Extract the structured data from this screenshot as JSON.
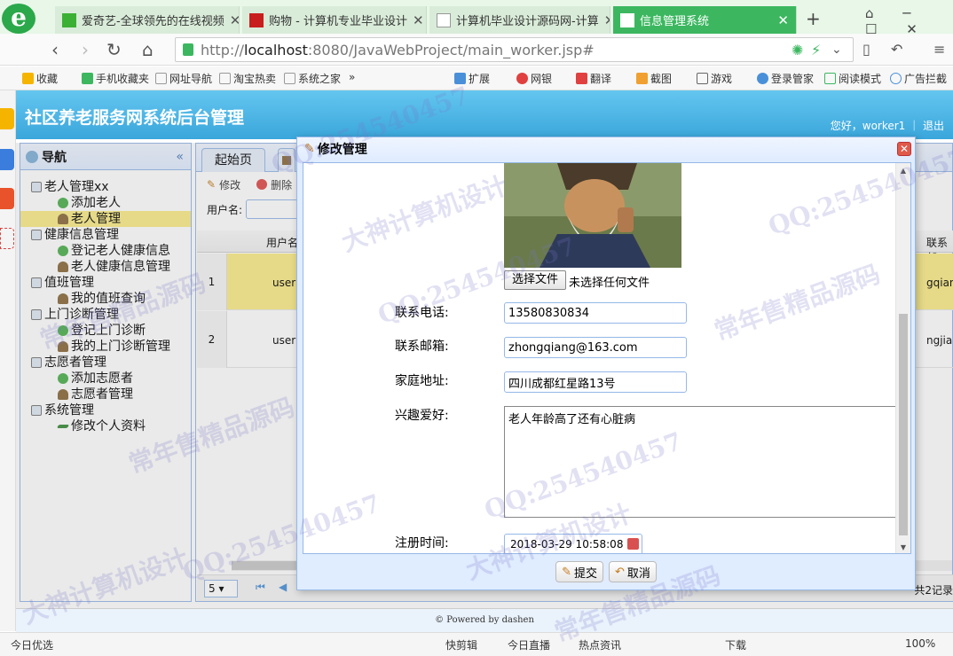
{
  "browser": {
    "tabs": [
      {
        "label": "爱奇艺-全球领先的在线视频",
        "favicon_color": "#3cb034"
      },
      {
        "label": "购物 - 计算机专业毕业设计",
        "favicon_color": "#c81e1e"
      },
      {
        "label": "计算机毕业设计源码网-计算",
        "favicon_color": "#ffffff"
      },
      {
        "label": "信息管理系统",
        "favicon_color": "#ffffff",
        "active": true
      }
    ],
    "new_tab": "+",
    "url_host": "localhost",
    "url_prefix": "http://",
    "url_rest": ":8080/JavaWebProject/main_worker.jsp#",
    "bookmarks": [
      "收藏",
      "手机收藏夹",
      "网址导航",
      "淘宝热卖",
      "系统之家",
      "»",
      "扩展",
      "网银",
      "翻译",
      "截图",
      "游戏",
      "登录管家",
      "阅读模式",
      "广告拦截"
    ]
  },
  "app": {
    "title": "社区养老服务网系统后台管理",
    "greeting": "您好，worker1",
    "logout": "退出",
    "footer": "Powered by dashen"
  },
  "nav": {
    "title": "导航",
    "collapse": "«",
    "tree": [
      {
        "label": "老人管理xx",
        "level": 1
      },
      {
        "label": "添加老人",
        "level": 2
      },
      {
        "label": "老人管理",
        "level": 2,
        "selected": true
      },
      {
        "label": "健康信息管理",
        "level": 1
      },
      {
        "label": "登记老人健康信息",
        "level": 2
      },
      {
        "label": "老人健康信息管理",
        "level": 2
      },
      {
        "label": "值班管理",
        "level": 1
      },
      {
        "label": "我的值班查询",
        "level": 2
      },
      {
        "label": "上门诊断管理",
        "level": 1
      },
      {
        "label": "登记上门诊断",
        "level": 2
      },
      {
        "label": "我的上门诊断管理",
        "level": 2
      },
      {
        "label": "志愿者管理",
        "level": 1
      },
      {
        "label": "添加志愿者",
        "level": 2
      },
      {
        "label": "志愿者管理",
        "level": 2
      },
      {
        "label": "系统管理",
        "level": 1
      },
      {
        "label": "修改个人资料",
        "level": 2
      }
    ]
  },
  "center": {
    "tabs": [
      "起始页"
    ],
    "toolbar": {
      "edit": "修改",
      "delete": "删除"
    },
    "search_label": "用户名:",
    "columns": [
      "用户名",
      "联系邮"
    ],
    "rows": [
      {
        "num": "1",
        "username": "user",
        "email": "gqiang"
      },
      {
        "num": "2",
        "username": "user",
        "email": "ngjia@"
      }
    ],
    "page_size": "5",
    "record_info": "共2记录"
  },
  "dialog": {
    "title": "修改管理",
    "file_button": "选择文件",
    "file_status": "未选择任何文件",
    "fields": {
      "phone_label": "联系电话:",
      "phone": "13580830834",
      "email_label": "联系邮箱:",
      "email": "zhongqiang@163.com",
      "address_label": "家庭地址:",
      "address": "四川成都红星路13号",
      "hobby_label": "兴趣爱好:",
      "hobby": "老人年龄高了还有心脏病",
      "regtime_label": "注册时间:",
      "regtime": "2018-03-29 10:58:08"
    },
    "submit": "提交",
    "cancel": "取消"
  },
  "statusbar": [
    "今日优选",
    "快剪辑",
    "今日直播",
    "热点资讯",
    "下载",
    "100%"
  ],
  "watermarks": [
    "QQ:254540457",
    "大神计算机设计",
    "常年售精品源码",
    "QQ:254540457",
    "常年售精品源码",
    "大神计算机设计",
    "QQ:254540457",
    "QQ:254540457",
    "常年售精品源码",
    "大神计算机设计",
    "QQ:254540457",
    "常年售精品源码"
  ]
}
